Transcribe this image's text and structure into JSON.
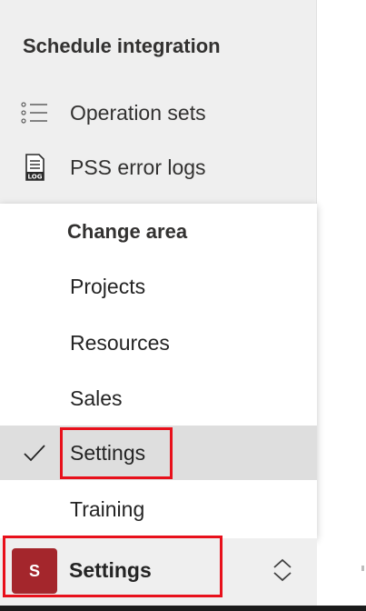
{
  "sidebar": {
    "group_title": "Schedule integration",
    "items": [
      {
        "label": "Operation sets",
        "icon": "list-icon"
      },
      {
        "label": "PSS error logs",
        "icon": "log-file-icon"
      }
    ]
  },
  "change_area": {
    "header": "Change area",
    "items": [
      {
        "label": "Projects",
        "selected": false
      },
      {
        "label": "Resources",
        "selected": false
      },
      {
        "label": "Sales",
        "selected": false
      },
      {
        "label": "Settings",
        "selected": true
      },
      {
        "label": "Training",
        "selected": false
      }
    ]
  },
  "area_switcher": {
    "avatar_letter": "S",
    "label": "Settings",
    "avatar_color": "#a4262c"
  },
  "highlight_color": "#e8101b"
}
